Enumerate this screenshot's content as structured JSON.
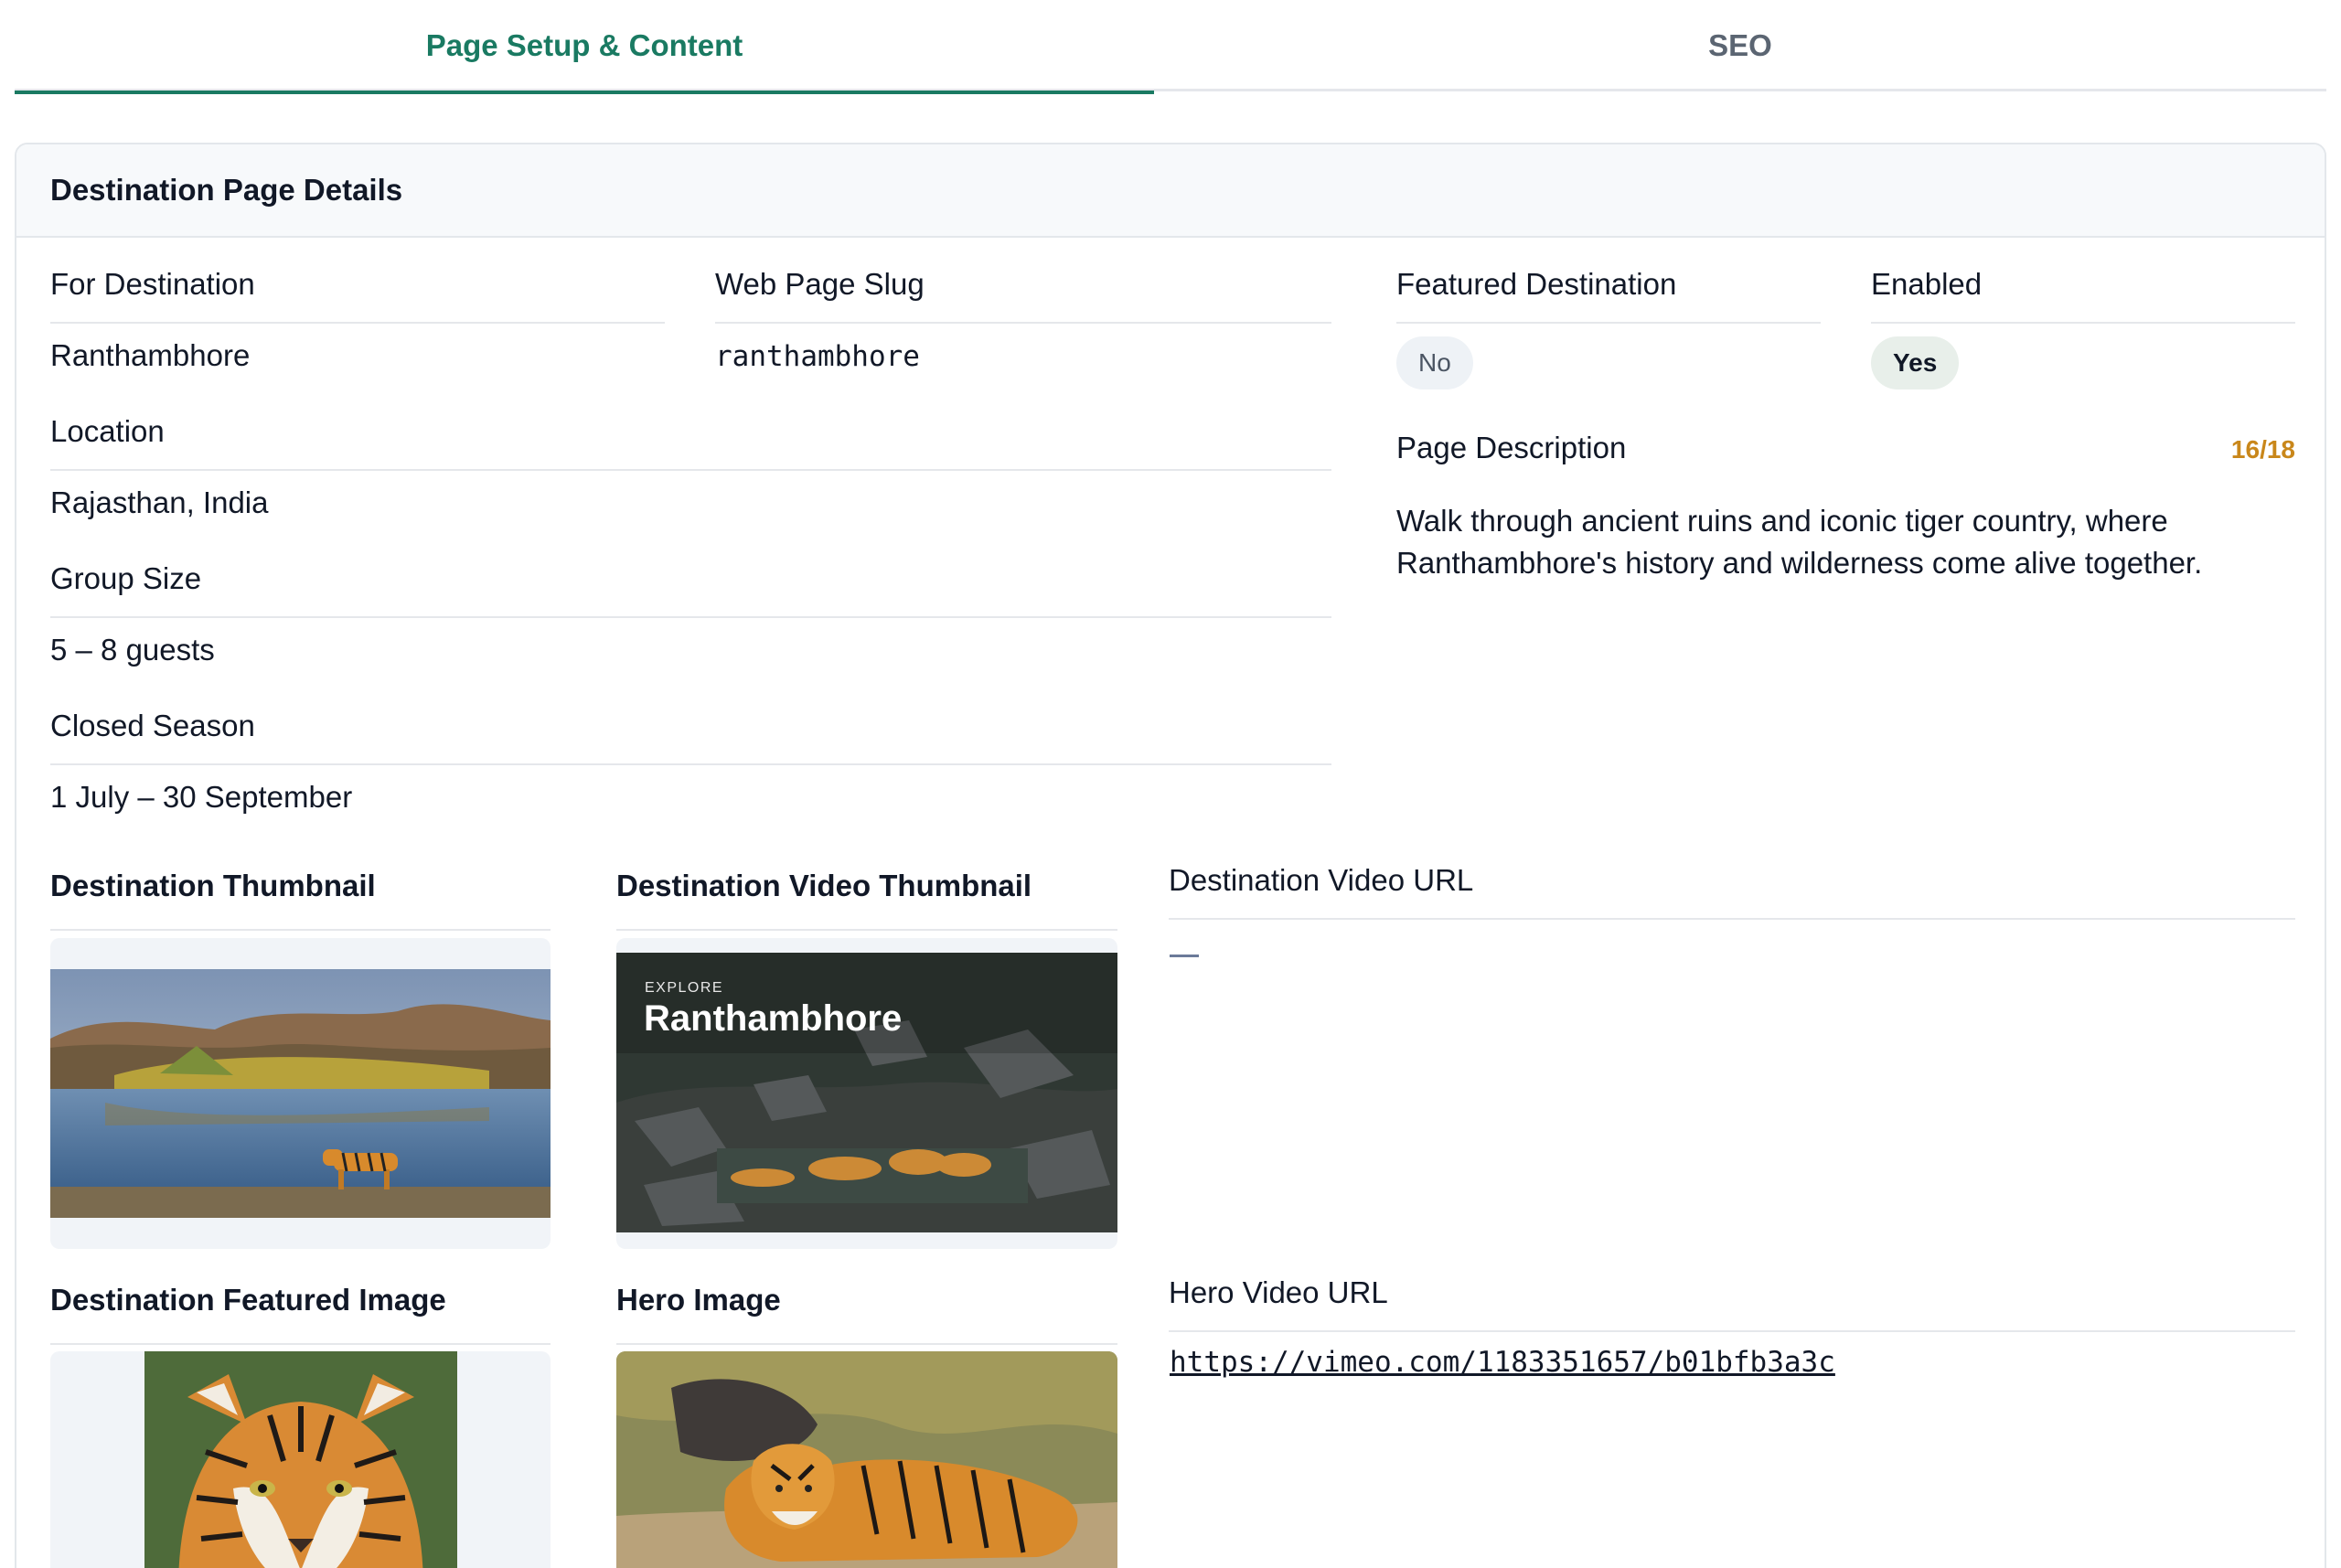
{
  "tabs": [
    {
      "label": "Page Setup & Content",
      "active": true
    },
    {
      "label": "SEO",
      "active": false
    }
  ],
  "card": {
    "title": "Destination Page Details"
  },
  "fields": {
    "for_destination": {
      "label": "For Destination",
      "value": "Ranthambhore"
    },
    "slug": {
      "label": "Web Page Slug",
      "value": "ranthambhore"
    },
    "featured": {
      "label": "Featured Destination",
      "value": "No"
    },
    "enabled": {
      "label": "Enabled",
      "value": "Yes"
    },
    "location": {
      "label": "Location",
      "value": "Rajasthan, India"
    },
    "group_size": {
      "label": "Group Size",
      "value": "5 – 8 guests"
    },
    "closed_season": {
      "label": "Closed Season",
      "value": "1 July – 30 September"
    },
    "page_description": {
      "label": "Page Description",
      "counter": "16/18",
      "value": "Walk through ancient ruins and iconic tiger country, where Ranthambhore's history and wilderness come alive together."
    }
  },
  "media": {
    "thumbnail": {
      "label": "Destination Thumbnail"
    },
    "video_thumbnail": {
      "label": "Destination Video Thumbnail",
      "overlay_kicker": "EXPLORE",
      "overlay_title": "Ranthambhore"
    },
    "video_url": {
      "label": "Destination Video URL",
      "value": "—"
    },
    "featured_image": {
      "label": "Destination Featured Image"
    },
    "hero_image": {
      "label": "Hero Image"
    },
    "hero_video_url": {
      "label": "Hero Video URL",
      "value": "https://vimeo.com/1183351657/b01bfb3a3c"
    }
  },
  "colors": {
    "accent": "#1a7a62",
    "counter": "#c9871a",
    "tab_inactive": "#5b6572"
  }
}
